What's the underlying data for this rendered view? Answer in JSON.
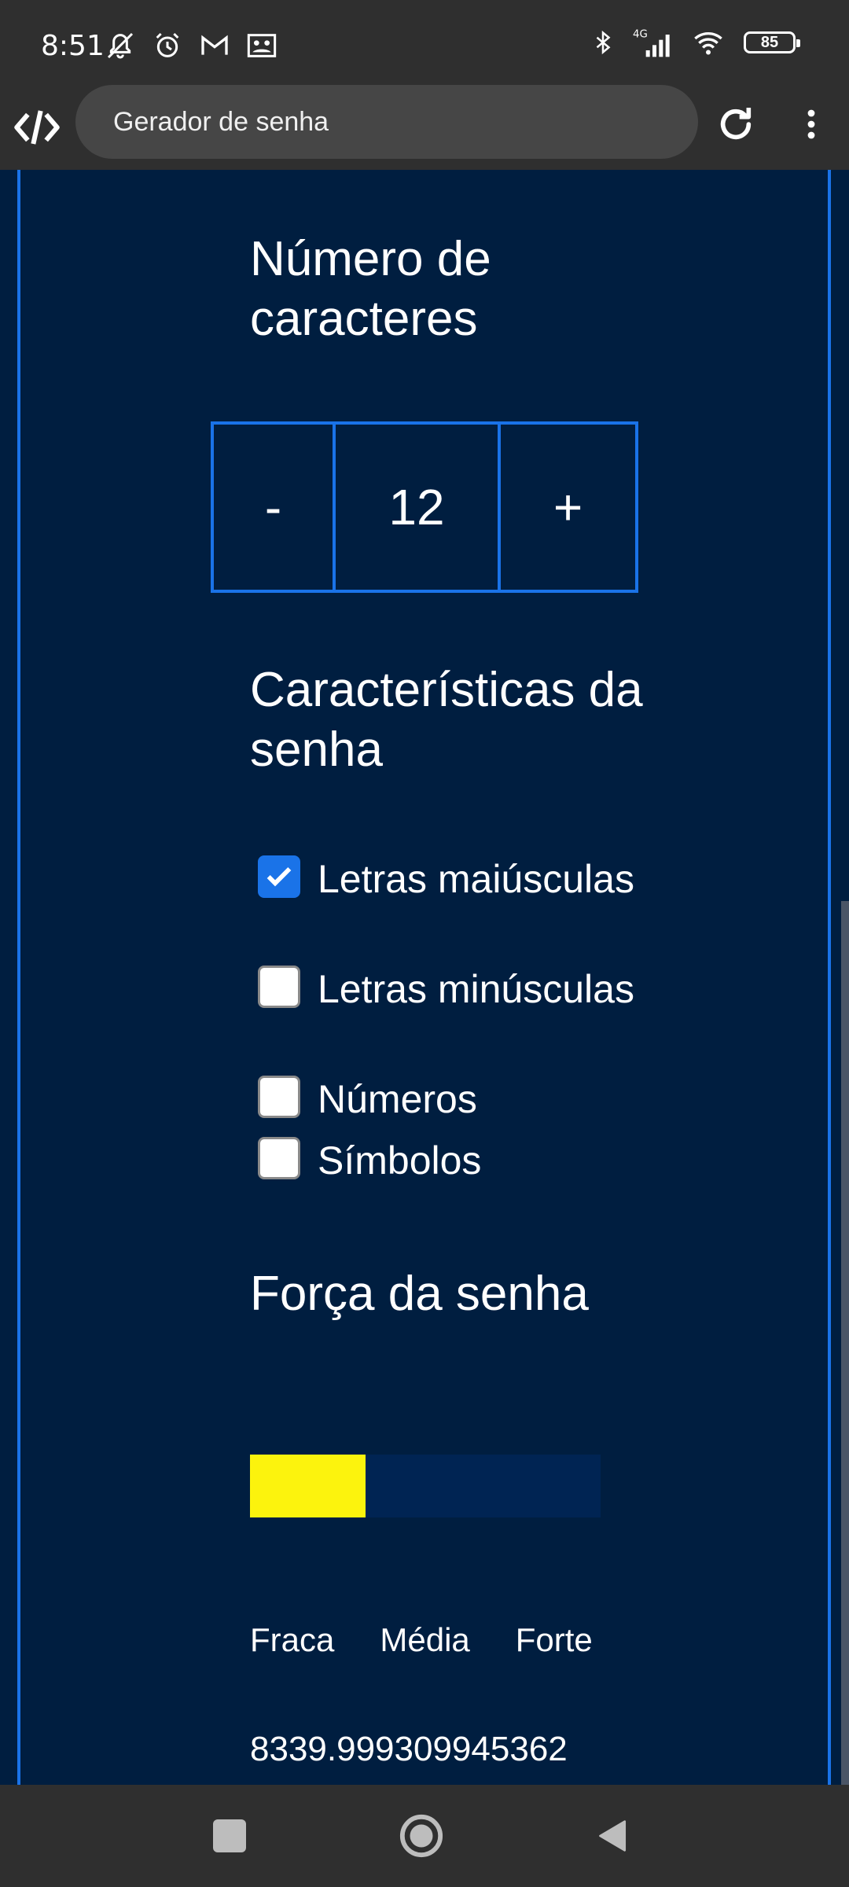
{
  "status_bar": {
    "time": "8:51",
    "battery": "85",
    "network": "4G",
    "icons": [
      "mute-icon",
      "alarm-icon",
      "gmail-icon",
      "photo-icon",
      "bluetooth-icon",
      "signal-icon",
      "wifi-icon",
      "battery-icon"
    ]
  },
  "browser": {
    "url_title": "Gerador de senha",
    "icons": [
      "site-logo-icon",
      "reload-icon",
      "more-vert-icon"
    ]
  },
  "length_section": {
    "title": "Número de caracteres",
    "minus_label": "-",
    "value": "12",
    "plus_label": "+"
  },
  "features_section": {
    "title": "Características da senha",
    "options": [
      {
        "label": "Letras maiúsculas",
        "checked": true
      },
      {
        "label": "Letras minúsculas",
        "checked": false
      },
      {
        "label": "Números",
        "checked": false
      },
      {
        "label": "Símbolos",
        "checked": false
      }
    ]
  },
  "strength_section": {
    "title": "Força da senha",
    "fill_fraction": 0.33,
    "fill_color": "#fcf30d",
    "labels": [
      "Fraca",
      "Média",
      "Forte"
    ],
    "score": "8339.999309945362"
  },
  "colors": {
    "background": "#001e40",
    "accent": "#1a73e8",
    "chrome": "#2f2f2f"
  }
}
